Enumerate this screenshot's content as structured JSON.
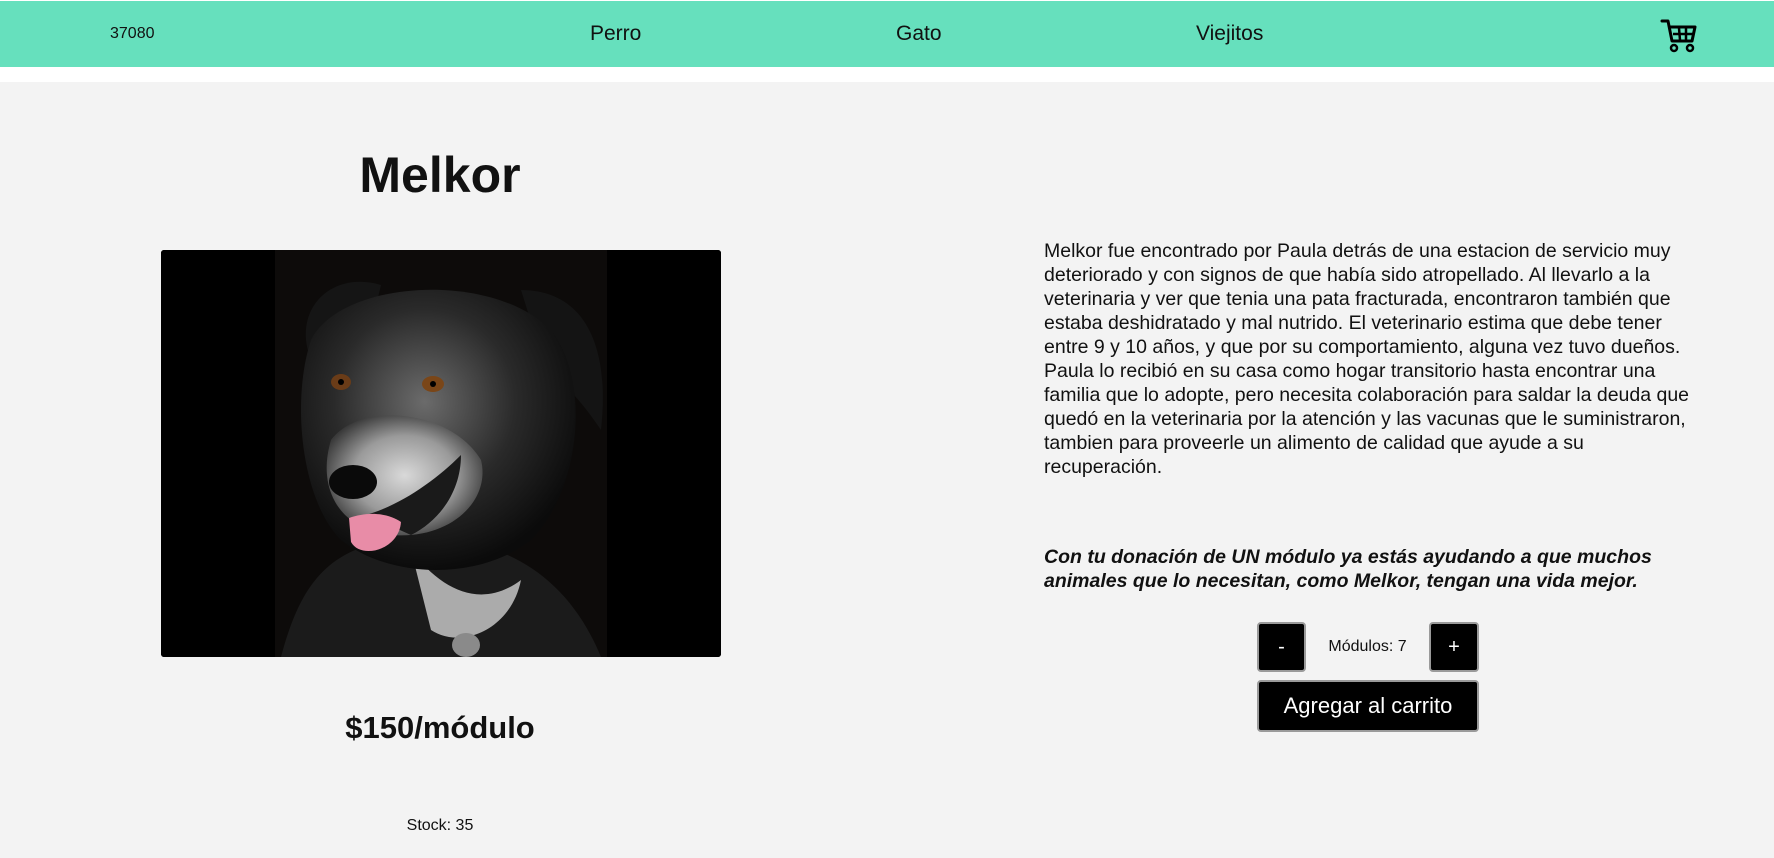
{
  "header": {
    "code": "37080",
    "nav": [
      "Perro",
      "Gato",
      "Viejitos"
    ],
    "cart_icon": "shopping-cart-icon",
    "background_color": "#66e0bd"
  },
  "product": {
    "name": "Melkor",
    "image_alt": "Perro negro y canoso con la lengua afuera",
    "price": "$150/módulo",
    "stock": "Stock: 35",
    "description": "Melkor fue encontrado por Paula detrás de una estacion de servicio muy deteriorado y con signos de que había sido atropellado. Al llevarlo a la veterinaria y ver que tenia una pata fracturada, encontraron también que estaba deshidratado y mal nutrido. El veterinario estima que debe tener entre 9 y 10 años, y que por su comportamiento, alguna vez tuvo dueños. Paula lo recibió en su casa como hogar transitorio hasta encontrar una familia que lo adopte, pero necesita colaboración para saldar la deuda que quedó en la veterinaria por la atención y las vacunas que le suministraron, tambien para proveerle un alimento de calidad que ayude a su recuperación.",
    "call_to_action": "Con tu donación de UN módulo ya estás ayudando a que muchos animales que lo necesitan, como Melkor, tengan una vida mejor."
  },
  "counter": {
    "minus_label": "-",
    "plus_label": "+",
    "modules_text": "Módulos: 7",
    "modules": 7
  },
  "actions": {
    "add_to_cart_label": "Agregar al carrito"
  }
}
